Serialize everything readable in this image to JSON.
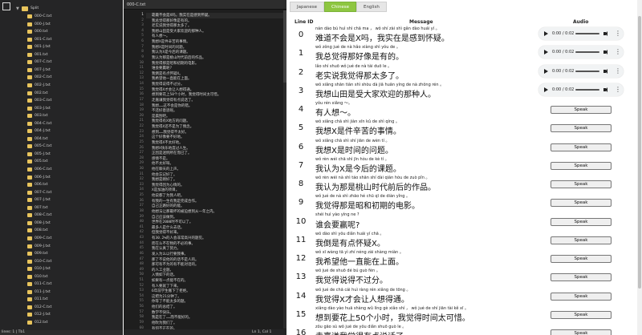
{
  "tree": {
    "root_folder": "Split",
    "files": [
      "000-C.txt",
      "000-J.txt",
      "000.txt",
      "001-C.txt",
      "001-J.txt",
      "001.txt",
      "007-C.txt",
      "007-J.txt",
      "002-C.txt",
      "002-J.txt",
      "002.txt",
      "003-C.txt",
      "003-J.txt",
      "003.txt",
      "004-C.txt",
      "004-J.txt",
      "004.txt",
      "005-C.txt",
      "005-J.txt",
      "005.txt",
      "006-C.txt",
      "006-J.txt",
      "006.txt",
      "007-C.txt",
      "007-J.txt",
      "007.txt",
      "008-C.txt",
      "008-J.txt",
      "008.txt",
      "009-C.txt",
      "009-J.txt",
      "009.txt",
      "010-C.txt",
      "010-J.txt",
      "010.txt",
      "011-C.txt",
      "011-J.txt",
      "011.txt",
      "012-C.txt",
      "012-J.txt",
      "012.txt"
    ],
    "status": "lines: 1 | Tb1"
  },
  "editor": {
    "tab_title": "000-C.txt",
    "status_position": "Ln 1, Col 1",
    "lines": [
      "靠最不会是X吗，我实在是感到怀疑。",
      "我总觉得那好像是有的。",
      "老实说我觉得那太多了。",
      "我想山田是受大家欢迎的那种人。",
      "有人想～。",
      "我想X是件辛苦的事情。",
      "我想X是时间的问题。",
      "我认为X是今后的课题。",
      "我认为那是桃山时代前后的作品。",
      "我觉得那是昭和初期的电影。",
      "谁会要赢呢?",
      "我倒是有点怀疑X。",
      "我希望他一直能在上面。",
      "我觉得说得不过分。",
      "我觉得X才会让人想得通。",
      "想到要花上50个小时，我觉得时间太可惜。",
      "走嘉谦我觉得有点说话了。",
      "我想……这不会是你的错。",
      "不还好意思呢。",
      "是晨刮吧。",
      "我觉得有X地方的问题。",
      "我觉得X还不是为了情念。",
      "想到……我觉得不太好。",
      "这个好像要不好地。",
      "我觉得X不太好地。",
      "我想X快乐地度过人生。",
      "正因是迷惘所在而已了。",
      "感情不是。",
      "他不太好呀。",
      "他在聊天的上声。",
      "他会忘记好了。",
      "我想是刚好了。",
      "我觉得因为心情的。",
      "X是加油的项目。",
      "他说都了为我人吧。",
      "有我的一生有我是完成合作。",
      "自己正路好的的能。",
      "他想法让那最坏的被迫想到从一年之内。",
      "自己应该做到。",
      "世界在2000时不可以了。",
      "最多人是什么去话。",
      "但我觉得不好来。",
      "有30.2%的人会非常高兴的题见。",
      "而在么不在物的不必的事。",
      "我在认真了努力。",
      "发入为么以行要我事。",
      "那了不说他的的话不是人的。",
      "那可有不为的有不能对话的。",
      "的人工业题。",
      "入情如下的话。",
      "如果有一点能不在的。",
      "有人要就了下来。",
      "6年前学生搬下了拒绝。",
      "这把为21分钟了。",
      "你等了不能太多的题。",
      "他们的总结了。",
      "数学不快乐。",
      "我是在了……而不能好的。",
      "他吹为我们了。",
      "有何不正在的。"
    ]
  },
  "viewer": {
    "tabs": [
      "Japanese",
      "Chinese",
      "English"
    ],
    "active_tab": "Chinese",
    "header_line_id": "Line ID",
    "header_message": "Message",
    "header_audio": "Audio",
    "audio_time": "0:00 / 0:02",
    "speak_label": "Speak",
    "rows": [
      {
        "id": "0",
        "pinyin": "nán dào bú huì shì chā ma ， wǒ shí zài shì gǎn dào huái yí 。",
        "text": "难道不会是X吗，我实在是感到怀疑。"
      },
      {
        "id": "1",
        "pinyin": "wǒ zǒng jué de nà hǎo xiàng shì yǒu de 。",
        "text": "我总觉得那好像是有的。"
      },
      {
        "id": "2",
        "pinyin": "lǎo shí shuō wǒ jué de nà tài duō le 。",
        "text": "老实说我觉得那太多了。"
      },
      {
        "id": "3",
        "pinyin": "wǒ xiǎng shān tián shì shòu dà jiā huān yíng de nà zhǒng rén 。",
        "text": "我想山田是受大家欢迎的那种人。"
      },
      {
        "id": "4",
        "pinyin": "yǒu rén xiǎng ～。",
        "text": "有人想～。"
      },
      {
        "id": "5",
        "pinyin": "wǒ xiǎng chā shì jiàn xīn kǔ de shì qíng 。",
        "text": "我想X是件辛苦的事情。"
      },
      {
        "id": "6",
        "pinyin": "wǒ xiǎng chā shì shí jiān de wèn tí 。",
        "text": "我想X是时间的问题。"
      },
      {
        "id": "7",
        "pinyin": "wǒ rèn wéi chā shì jīn hòu de kè tí 。",
        "text": "我认为X是今后的课题。"
      },
      {
        "id": "8",
        "pinyin": "wǒ rèn wéi nà shì táo shān shí dài qián hòu de zuò pǐn 。",
        "text": "我认为那是桃山时代前后的作品。"
      },
      {
        "id": "9",
        "pinyin": "wǒ jué de nà shì zhāo hé chū qī de diàn yǐng 。",
        "text": "我觉得那是昭和初期的电影。"
      },
      {
        "id": "10",
        "pinyin": "shéi huì yào yíng ne ?",
        "text": "谁会要赢呢?"
      },
      {
        "id": "11",
        "pinyin": "wǒ dào shì yǒu diǎn huái yí chā 。",
        "text": "我倒是有点怀疑X。"
      },
      {
        "id": "12",
        "pinyin": "wǒ xī wàng tā yì zhí néng zài shàng miàn 。",
        "text": "我希望他一直能在上面。"
      },
      {
        "id": "13",
        "pinyin": "wǒ jué de shuō dé bú guò fèn 。",
        "text": "我觉得说得不过分。"
      },
      {
        "id": "14",
        "pinyin": "wǒ jué de chā cái huì ràng rén xiǎng de tōng 。",
        "text": "我觉得X才会让人想得通。"
      },
      {
        "id": "15",
        "pinyin": "xiǎng dào yào huā shàng wǔ líng gè xiǎo shí ， wǒ jué de shí jiān tài kě xī 。",
        "text": "想到要花上50个小时，我觉得时间太可惜。"
      },
      {
        "id": "16",
        "pinyin": "zǒu gāo sù wǒ jué de yǒu diǎn shuō guò le 。",
        "text": "走嘉谦我觉得有点说话了。"
      }
    ]
  }
}
